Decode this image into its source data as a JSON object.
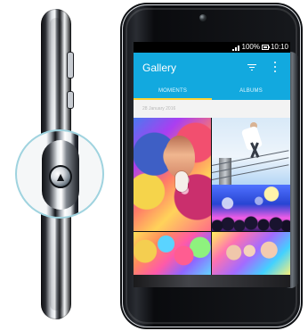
{
  "status_bar": {
    "battery_text": "100%",
    "time": "10:10"
  },
  "app": {
    "title": "Gallery"
  },
  "tabs": [
    {
      "label": "MOMENTS",
      "selected": true
    },
    {
      "label": "ALBUMS",
      "selected": false
    }
  ],
  "date_header": "28 January 2016",
  "colors": {
    "accent": "#12a9df",
    "tab_indicator": "#ffd233"
  },
  "icons": {
    "filter": "filter-icon",
    "more": "more-vert-icon",
    "signal": "signal-icon",
    "battery": "battery-icon",
    "camera": "camera-icon",
    "brand_logo": "alcatel-logo-icon"
  }
}
